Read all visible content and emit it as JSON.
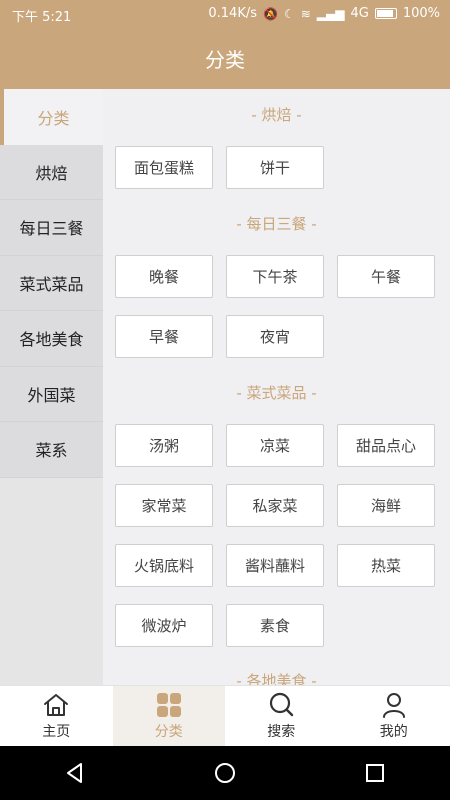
{
  "status_bar": {
    "time": "下午 5:21",
    "speed": "0.14K/s",
    "network": "4G",
    "battery": "100%"
  },
  "header": {
    "title": "分类"
  },
  "sidebar": {
    "items": [
      {
        "label": "分类",
        "active": true
      },
      {
        "label": "烘焙"
      },
      {
        "label": "每日三餐"
      },
      {
        "label": "菜式菜品"
      },
      {
        "label": "各地美食"
      },
      {
        "label": "外国菜"
      },
      {
        "label": "菜系"
      }
    ]
  },
  "sections": [
    {
      "title": "- 烘焙 -",
      "items": [
        "面包蛋糕",
        "饼干"
      ]
    },
    {
      "title": "- 每日三餐 -",
      "items": [
        "晚餐",
        "下午茶",
        "午餐",
        "早餐",
        "夜宵"
      ]
    },
    {
      "title": "- 菜式菜品 -",
      "items": [
        "汤粥",
        "凉菜",
        "甜品点心",
        "家常菜",
        "私家菜",
        "海鲜",
        "火锅底料",
        "酱料蘸料",
        "热菜",
        "微波炉",
        "素食"
      ]
    },
    {
      "title": "- 各地美食 -",
      "items": []
    }
  ],
  "bottom_nav": {
    "items": [
      {
        "label": "主页",
        "icon": "home-icon"
      },
      {
        "label": "分类",
        "icon": "category-icon",
        "active": true
      },
      {
        "label": "搜索",
        "icon": "search-icon"
      },
      {
        "label": "我的",
        "icon": "user-icon"
      }
    ]
  },
  "colors": {
    "accent": "#c9a67b",
    "content_bg": "#f0eff1",
    "sidebar_bg": "#dcdbdd"
  }
}
